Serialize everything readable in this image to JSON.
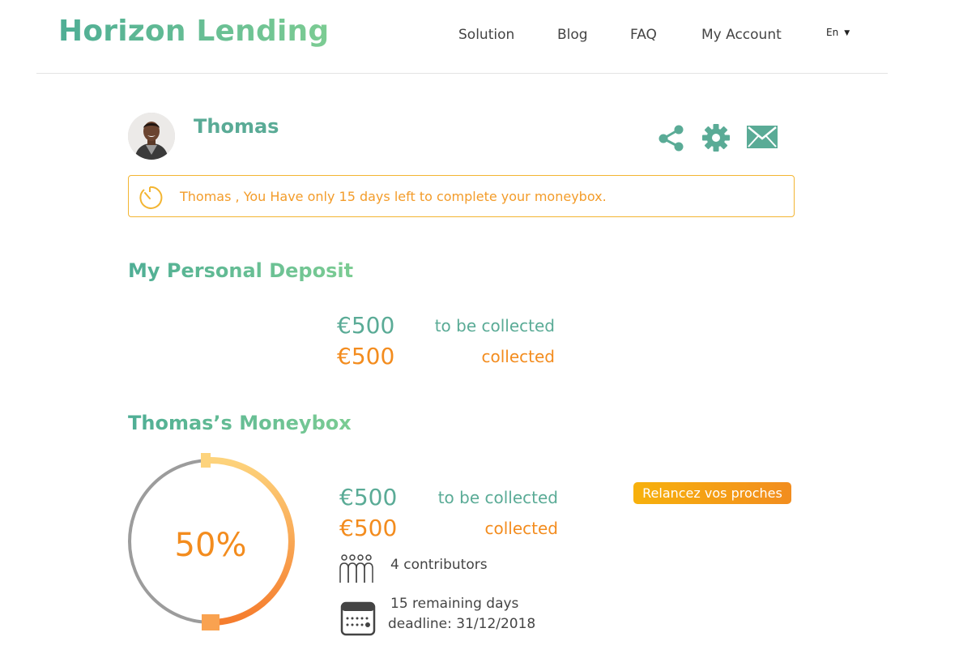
{
  "header": {
    "brand": "Horizon Lending",
    "nav": [
      "Solution",
      "Blog",
      "FAQ",
      "My Account"
    ],
    "language": "En"
  },
  "profile": {
    "name": "Thomas",
    "actions": [
      "share-icon",
      "gear-icon",
      "mail-icon"
    ]
  },
  "alert": {
    "icon": "timer-icon",
    "text": "Thomas , You Have only 15 days left to complete your moneybox."
  },
  "deposit": {
    "title": "My Personal Deposit",
    "to_collect_amount": "€500",
    "to_collect_label": "to be collected",
    "collected_amount": "€500",
    "collected_label": "collected"
  },
  "moneybox": {
    "title": "Thomas’s Moneybox",
    "progress_percent": 50,
    "progress_label": "50%",
    "to_collect_amount": "€500",
    "to_collect_label": "to be collected",
    "collected_amount": "€500",
    "collected_label": "collected",
    "cta_label": "Relancez vos proches",
    "contributors": "4 contributors",
    "remaining": "15 remaining days",
    "deadline": "deadline: 31/12/2018"
  },
  "colors": {
    "green": "#5aab96",
    "orange": "#f38c1e",
    "alert_border": "#f3b532"
  }
}
